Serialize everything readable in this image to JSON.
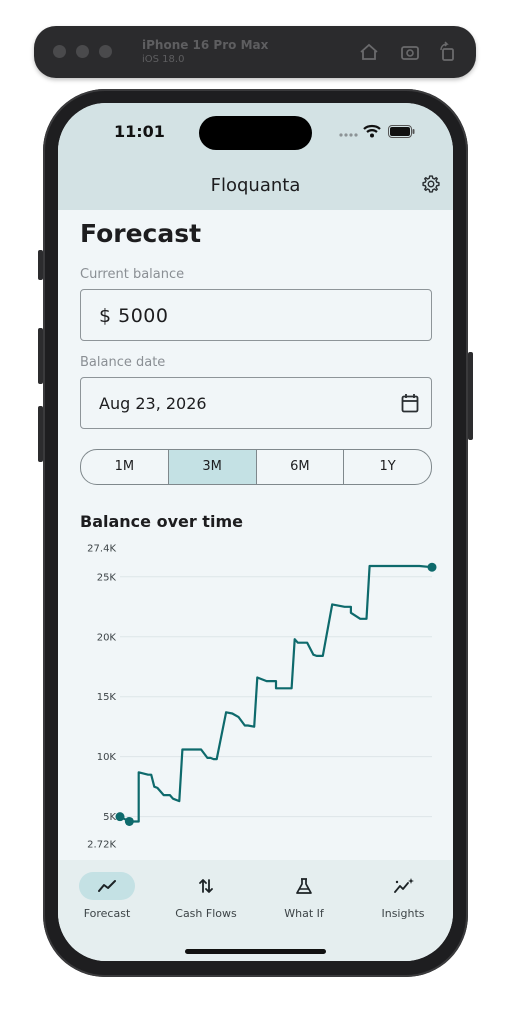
{
  "simulator": {
    "device": "iPhone 16 Pro Max",
    "os": "iOS 18.0"
  },
  "status_bar": {
    "time": "11:01"
  },
  "app": {
    "title": "Floquanta"
  },
  "forecast": {
    "heading": "Forecast",
    "balance_label": "Current balance",
    "balance_value": "$ 5000",
    "date_label": "Balance date",
    "date_value": "Aug 23, 2026",
    "ranges": [
      "1M",
      "3M",
      "6M",
      "1Y"
    ],
    "selected_range": "3M",
    "chart_title": "Balance over time"
  },
  "chart_data": {
    "type": "line",
    "title": "Balance over time",
    "xlabel": "",
    "ylabel": "",
    "y_ticks": [
      "27.4K",
      "25K",
      "20K",
      "15K",
      "10K",
      "5K",
      "2.72K"
    ],
    "ylim": [
      2720,
      27400
    ],
    "grid": true,
    "color": "#0e6a6c",
    "series": [
      {
        "x": [
          0,
          0.03,
          0.06,
          0.06,
          0.09,
          0.1,
          0.11,
          0.12,
          0.14,
          0.16,
          0.17,
          0.19,
          0.2,
          0.2,
          0.23,
          0.26,
          0.28,
          0.29,
          0.3,
          0.31,
          0.34,
          0.36,
          0.38,
          0.4,
          0.41,
          0.43,
          0.44,
          0.47,
          0.5,
          0.5,
          0.52,
          0.55,
          0.56,
          0.57,
          0.6,
          0.62,
          0.63,
          0.65,
          0.68,
          0.72,
          0.74,
          0.74,
          0.77,
          0.79,
          0.8,
          0.84,
          0.84,
          0.87,
          0.88,
          0.89,
          0.91,
          0.95,
          0.96,
          1.0
        ],
        "y": [
          5000,
          4600,
          4600,
          8700,
          8500,
          8500,
          7500,
          7400,
          6800,
          6800,
          6500,
          6300,
          10600,
          10600,
          10600,
          10600,
          9900,
          9900,
          9800,
          9800,
          13700,
          13600,
          13300,
          12600,
          12600,
          12500,
          16600,
          16300,
          16300,
          15700,
          15700,
          15700,
          19800,
          19500,
          19500,
          18500,
          18400,
          18400,
          22700,
          22500,
          22500,
          22000,
          21500,
          21500,
          25900,
          25900,
          25900,
          25900,
          25900,
          25900,
          25900,
          25900,
          25900,
          25800
        ]
      }
    ]
  },
  "nav": {
    "items": [
      {
        "label": "Forecast",
        "icon": "trending-line-icon",
        "active": true
      },
      {
        "label": "Cash Flows",
        "icon": "swap-arrows-icon",
        "active": false
      },
      {
        "label": "What If",
        "icon": "flask-icon",
        "active": false
      },
      {
        "label": "Insights",
        "icon": "sparkle-chart-icon",
        "active": false
      }
    ]
  }
}
